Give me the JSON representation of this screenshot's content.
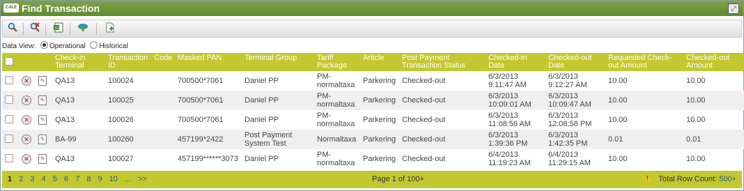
{
  "window": {
    "logo_text": "CALE",
    "title": "Find Transaction"
  },
  "toolbar": {
    "buttons": [
      {
        "name": "search-icon"
      },
      {
        "name": "clear-search-icon"
      },
      {
        "name": "export-excel-icon"
      },
      {
        "name": "upload-icon"
      },
      {
        "name": "new-document-icon"
      }
    ]
  },
  "data_view": {
    "label": "Data View:",
    "options": [
      "Operational",
      "Historical"
    ],
    "selected": "Operational"
  },
  "table": {
    "headers": [
      "Check-in Terminal",
      "Transaction ID",
      "Code",
      "Masked PAN",
      "Terminal Group",
      "Tariff Package",
      "Article",
      "Post Payment Transaction Status",
      "Checked-in Date",
      "Checked-out Date",
      "Requested Check-out Amount",
      "Checked-out Amount"
    ],
    "rows": [
      {
        "terminal": "QA13",
        "id": "100024",
        "code": "",
        "pan": "700500*7061",
        "group": "Daniel PP",
        "tariff": "PM-normaltaxa",
        "article": "Parkering",
        "status": "Checked-out",
        "checkin": "6/3/2013 9:11:47 AM",
        "checkout": "6/3/2013 9:12:27 AM",
        "req_amount": "10.00",
        "amount": "10.00"
      },
      {
        "terminal": "QA13",
        "id": "100025",
        "code": "",
        "pan": "700500*7061",
        "group": "Daniel PP",
        "tariff": "PM-normaltaxa",
        "article": "Parkering",
        "status": "Checked-out",
        "checkin": "6/3/2013 10:09:01 AM",
        "checkout": "6/3/2013 10:09:47 AM",
        "req_amount": "10.00",
        "amount": "10.00"
      },
      {
        "terminal": "QA13",
        "id": "100026",
        "code": "",
        "pan": "700500*7061",
        "group": "Daniel PP",
        "tariff": "PM-normaltaxa",
        "article": "Parkering",
        "status": "Checked-out",
        "checkin": "6/3/2013 11:08:58 AM",
        "checkout": "6/3/2013 12:08:58 PM",
        "req_amount": "10.00",
        "amount": "10.00"
      },
      {
        "terminal": "BA-99",
        "id": "100260",
        "code": "",
        "pan": "457199*2422",
        "group": "Post Payment System Test",
        "tariff": "Normaltaxa",
        "article": "Parkering",
        "status": "Checked-out",
        "checkin": "6/3/2013 1:39:36 PM",
        "checkout": "6/3/2013 1:42:35 PM",
        "req_amount": "0.01",
        "amount": "0.01"
      },
      {
        "terminal": "QA13",
        "id": "100027",
        "code": "",
        "pan": "457199******3073",
        "group": "Daniel PP",
        "tariff": "PM-normaltaxa",
        "article": "Parkering",
        "status": "Checked-out",
        "checkin": "6/4/2013 11:19:23 AM",
        "checkout": "6/4/2013 11:29:15 AM",
        "req_amount": "10.00",
        "amount": "10.00"
      }
    ]
  },
  "pagination": {
    "pages": [
      "1",
      "2",
      "3",
      "4",
      "5",
      "6",
      "7",
      "8",
      "9",
      "10",
      "...",
      ">>"
    ],
    "current": "1",
    "page_info": "Page 1 of 100+",
    "total_label": "Total Row Count:",
    "total_count": "500+"
  },
  "colors": {
    "title_bar": "#6b9437",
    "grid_header": "#c2c830",
    "link": "#2a5c8a"
  }
}
